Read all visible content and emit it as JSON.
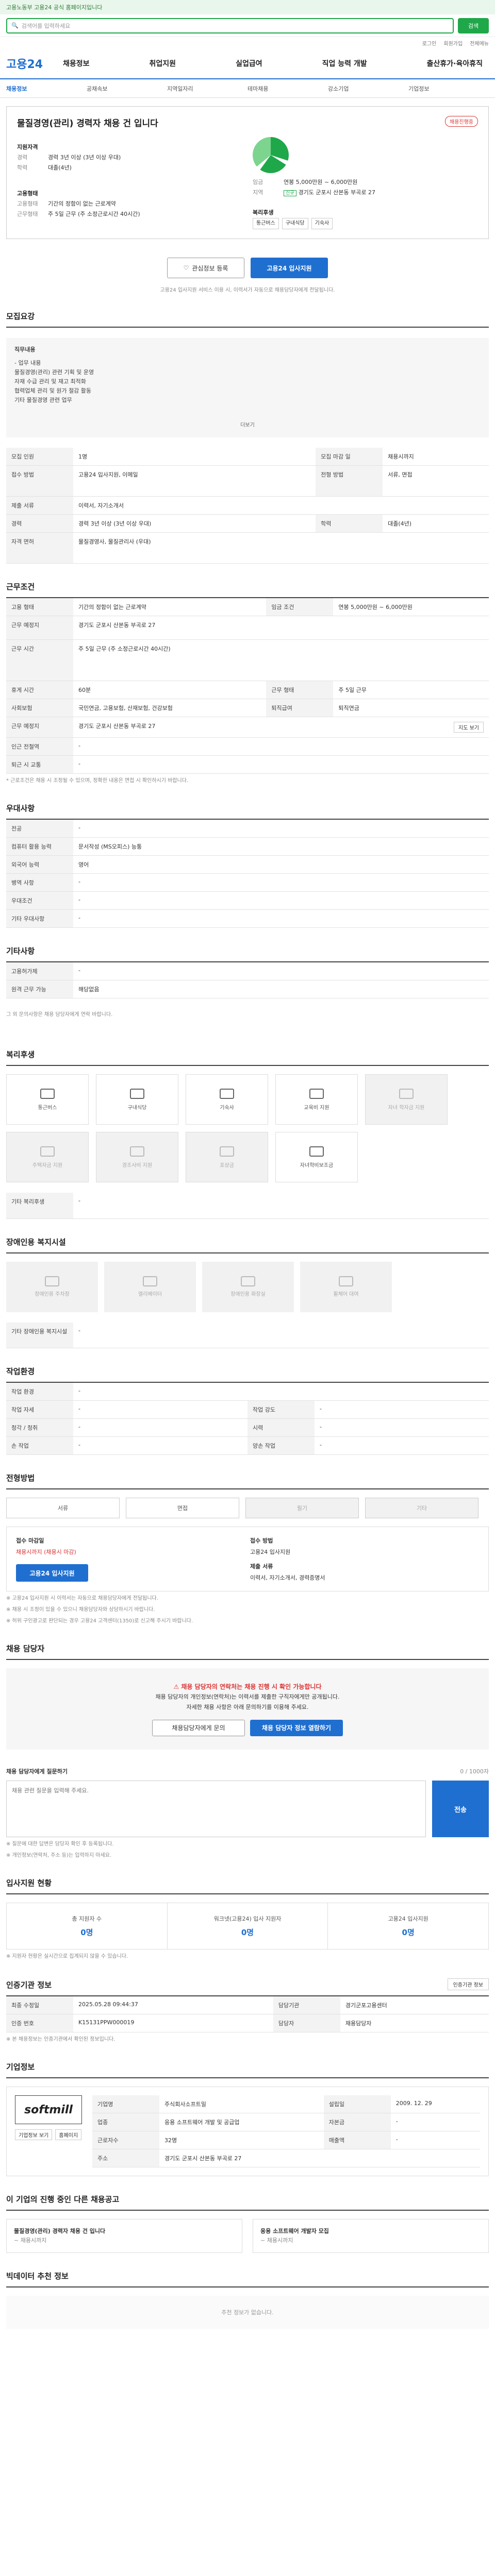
{
  "topbar": {
    "notice": "고용노동부 고용24 공식 홈페이지입니다"
  },
  "search": {
    "placeholder": "검색어를 입력하세요",
    "button": "검색"
  },
  "util": {
    "links": [
      "로그인",
      "회원가입",
      "전체메뉴"
    ]
  },
  "gnb": {
    "logo": "고용24",
    "menu": [
      "채용정보",
      "취업지원",
      "실업급여",
      "직업 능력 개발",
      "출산휴가·육아휴직"
    ]
  },
  "subnav": [
    "채용정보",
    "공채속보",
    "지역일자리",
    "테마채용",
    "강소기업",
    "기업정보"
  ],
  "header": {
    "title": "물질경영(관리) 경력자 채용 건 입니다",
    "status_tag": "채용진행중",
    "recruit_label": "지원자격",
    "career_k": "경력",
    "career_v": "경력 3년 이상 (3년 이상 우대)",
    "edu_k": "학력",
    "edu_v": "대졸(4년)",
    "cond_label": "고용형태",
    "type_k": "고용형태",
    "type_v": "기간의 정함이 없는 근로계약",
    "time_k": "근무형태",
    "time_v": "주 5일 근무 (주 소정근로시간 40시간)",
    "wage_label": "임금",
    "wage_k": "임금",
    "wage_v": "연봉 5,000만원 ~ 6,000만원",
    "loc_label": "근무지역",
    "loc_k": "지역",
    "loc_v": "경기도 군포시 산본동 부곡로 27",
    "loc_tag": "신규",
    "benefit_label": "복리후생",
    "benefits": [
      "통근버스",
      "구내식당",
      "기숙사"
    ]
  },
  "actions": {
    "scrap": "관심정보 등록",
    "apply": "고용24 입사지원"
  },
  "action_note": "고용24 입사지원 서비스 이용 시, 이력서가 자동으로 채용담당자에게 전달됩니다.",
  "detail": {
    "title": "모집요강",
    "duty_title": "직무내용",
    "duty_lines": [
      "- 업무 내용",
      "물질경영(관리) 관련 기획 및 운영",
      "자재 수급 관리 및 재고 최적화",
      "협력업체 관리 및 원가 절감 활동",
      "기타 물질경영 관련 업무"
    ],
    "more": "더보기",
    "rows": [
      {
        "k": "모집 인원",
        "v": "1명",
        "k2": "모집 마감 일",
        "v2": "채용시까지"
      },
      {
        "k": "접수 방법",
        "v": "고용24 입사지원, 이메일",
        "k2": "전형 방법",
        "v2": "서류, 면접"
      },
      {
        "k": "제출 서류",
        "v": "이력서, 자기소개서",
        "k2": "",
        "v2": ""
      },
      {
        "k": "경력",
        "v": "경력 3년 이상 (3년 이상 우대)",
        "k2": "학력",
        "v2": "대졸(4년)"
      },
      {
        "k": "자격 면허",
        "v": "물질경영사, 물질관리사 (우대)",
        "k2": "",
        "v2": ""
      }
    ]
  },
  "conditions": {
    "title": "근무조건",
    "rows": [
      {
        "k": "고용 형태",
        "v": "기간의 정함이 없는 근로계약",
        "k2": "임금 조건",
        "v2": "연봉 5,000만원 ~ 6,000만원"
      },
      {
        "k": "근무 예정지",
        "v": "경기도 군포시 산본동 부곡로 27",
        "k2": "",
        "v2": ""
      },
      {
        "k": "근무 시간",
        "v": "주 5일 근무 (주 소정근로시간 40시간)",
        "k2": "",
        "v2": ""
      },
      {
        "k": "휴게 시간",
        "v": "60분",
        "k2": "근무 형태",
        "v2": "주 5일 근무"
      },
      {
        "k": "사회보험",
        "v": "국민연금, 고용보험, 산재보험, 건강보험",
        "k2": "퇴직급여",
        "v2": "퇴직연금"
      },
      {
        "k": "근무 예정지",
        "v": "경기도 군포시 산본동 부곡로 27",
        "k2": "",
        "v2": ""
      },
      {
        "k": "인근 전철역",
        "v": "-",
        "k2": "",
        "v2": ""
      },
      {
        "k": "퇴근 시 교통",
        "v": "-",
        "k2": "",
        "v2": ""
      }
    ],
    "map_btn": "지도 보기",
    "footnote": "* 근로조건은 채용 시 조정될 수 있으며, 정확한 내용은 면접 시 확인하시기 바랍니다."
  },
  "prefer": {
    "title": "우대사항",
    "rows": [
      {
        "k": "전공",
        "v": "-"
      },
      {
        "k": "컴퓨터 활용 능력",
        "v": "문서작성 (MS오피스) 능통"
      },
      {
        "k": "외국어 능력",
        "v": "영어"
      },
      {
        "k": "병역 사항",
        "v": "-"
      },
      {
        "k": "우대조건",
        "v": "-"
      },
      {
        "k": "기타 우대사항",
        "v": "-"
      }
    ]
  },
  "other": {
    "title": "기타사항",
    "rows": [
      {
        "k": "고용허가제",
        "v": "-"
      },
      {
        "k": "원격 근무 가능",
        "v": "해당없음"
      }
    ],
    "notes": "그 외 문의사항은 채용 담당자에게 연락 바랍니다."
  },
  "welfare": {
    "title": "복리후생",
    "cards": [
      {
        "label": "통근버스",
        "on": true
      },
      {
        "label": "구내식당",
        "on": true
      },
      {
        "label": "기숙사",
        "on": true
      },
      {
        "label": "교육비 지원",
        "on": true
      },
      {
        "label": "자녀 학자금 지원",
        "on": false
      },
      {
        "label": "주택자금 지원",
        "on": false
      },
      {
        "label": "경조사비 지원",
        "on": false
      },
      {
        "label": "포상금",
        "on": false
      },
      {
        "label": "자녀학비보조금",
        "on": true
      }
    ],
    "other_label": "기타 복리후생",
    "other_value": "-"
  },
  "disability": {
    "title": "장애인용 복지시설",
    "cards": [
      "장애인용 주차장",
      "엘리베이터",
      "장애인용 화장실",
      "휠체어 대여"
    ],
    "other_label": "기타 장애인용 복지시설",
    "other_value": "-"
  },
  "workenv": {
    "title": "작업환경",
    "rows": [
      {
        "k": "작업 환경",
        "v": "-",
        "k2": "",
        "v2": ""
      },
      {
        "k": "작업 자세",
        "v": "-",
        "k2": "작업 강도",
        "v2": "-"
      },
      {
        "k": "청각 / 청취",
        "v": "-",
        "k2": "시력",
        "v2": "-"
      },
      {
        "k": "손 작업",
        "v": "-",
        "k2": "양손 작업",
        "v2": "-"
      }
    ]
  },
  "process": {
    "title": "전형방법",
    "tabs": [
      {
        "label": "서류",
        "on": true
      },
      {
        "label": "면접",
        "on": true
      },
      {
        "label": "필기",
        "on": false
      },
      {
        "label": "기타",
        "on": false
      }
    ],
    "apply_label": "접수 마감일",
    "apply_value": "채용시까지 (채용시 마감)",
    "method_label": "접수 방법",
    "method_value": "고용24 입사지원",
    "docs_label": "제출 서류",
    "docs_value": "이력서, 자기소개서, 경력증명서",
    "apply_btn": "고용24 입사지원",
    "notes": [
      "※ 고용24 입사지원 시 이력서는 자동으로 채용담당자에게 전달됩니다.",
      "※ 채용 시 조정이 있을 수 있으니 채용담당자와 상담하시기 바랍니다.",
      "※ 허위 구인광고로 판단되는 경우 고용24 고객센터(1350)로 신고해 주시기 바랍니다."
    ]
  },
  "contact": {
    "title": "채용 담당자",
    "headline": "채용 담당자의 연락처는 채용 진행 시 확인 가능합니다",
    "line1": "채용 담당자의 개인정보(연락처)는 이력서를 제출한 구직자에게만 공개됩니다.",
    "line2": "자세한 채용 사항은 아래 문의하기를 이용해 주세요.",
    "btn1": "채용담당자에게 문의",
    "btn2": "채용 담당자 정보 열람하기"
  },
  "qna": {
    "title": "채용 담당자에게 질문하기",
    "count": "0 / 1000자",
    "placeholder": "채용 관련 질문을 입력해 주세요.",
    "submit": "전송",
    "notes": [
      "※ 질문에 대한 답변은 담당자 확인 후 등록됩니다.",
      "※ 개인정보(연락처, 주소 등)는 입력하지 마세요."
    ]
  },
  "stats": {
    "title": "입사지원 현황",
    "items": [
      {
        "label": "총 지원자 수",
        "value": "0명"
      },
      {
        "label": "워크넷(고용24) 입사 지원자",
        "value": "0명"
      },
      {
        "label": "고용24 입사지원",
        "value": "0명"
      }
    ],
    "note": "※ 지원자 현황은 실시간으로 집계되지 않을 수 있습니다."
  },
  "info": {
    "title": "인증기관 정보",
    "rows": [
      {
        "k": "최종 수정일",
        "v": "2025.05.28 09:44:37",
        "k2": "담당기관",
        "v2": "경기군포고용센터"
      },
      {
        "k": "인증 번호",
        "v": "K15131PPW000019",
        "k2": "담당자",
        "v2": "채용담당자"
      }
    ],
    "btn": "인증기관 정보",
    "note": "※ 본 채용정보는 인증기관에서 확인된 정보입니다."
  },
  "company": {
    "title": "기업정보",
    "logo": "softmill",
    "rows": [
      {
        "k": "기업명",
        "v": "주식회사소프트밀",
        "k2": "설립일",
        "v2": "2009. 12. 29"
      },
      {
        "k": "업종",
        "v": "응용 소프트웨어 개발 및 공급업",
        "k2": "자본금",
        "v2": "-"
      },
      {
        "k": "근로자수",
        "v": "32명",
        "k2": "매출액",
        "v2": "-"
      },
      {
        "k": "주소",
        "v": "경기도 군포시 산본동 부곡로 27",
        "k2": "",
        "v2": ""
      }
    ],
    "btns": [
      "기업정보 보기",
      "홈페이지"
    ]
  },
  "ongoing": {
    "title": "이 기업의 진행 중인 다른 채용공고",
    "items": [
      {
        "title": "물질경영(관리) 경력자 채용 건 입니다",
        "date": "~ 채용시까지"
      },
      {
        "title": "응용 소프트웨어 개발자 모집",
        "date": "~ 채용시까지"
      }
    ]
  },
  "similar": {
    "title": "빅데이터 추천 정보",
    "empty": "추천 정보가 없습니다."
  }
}
